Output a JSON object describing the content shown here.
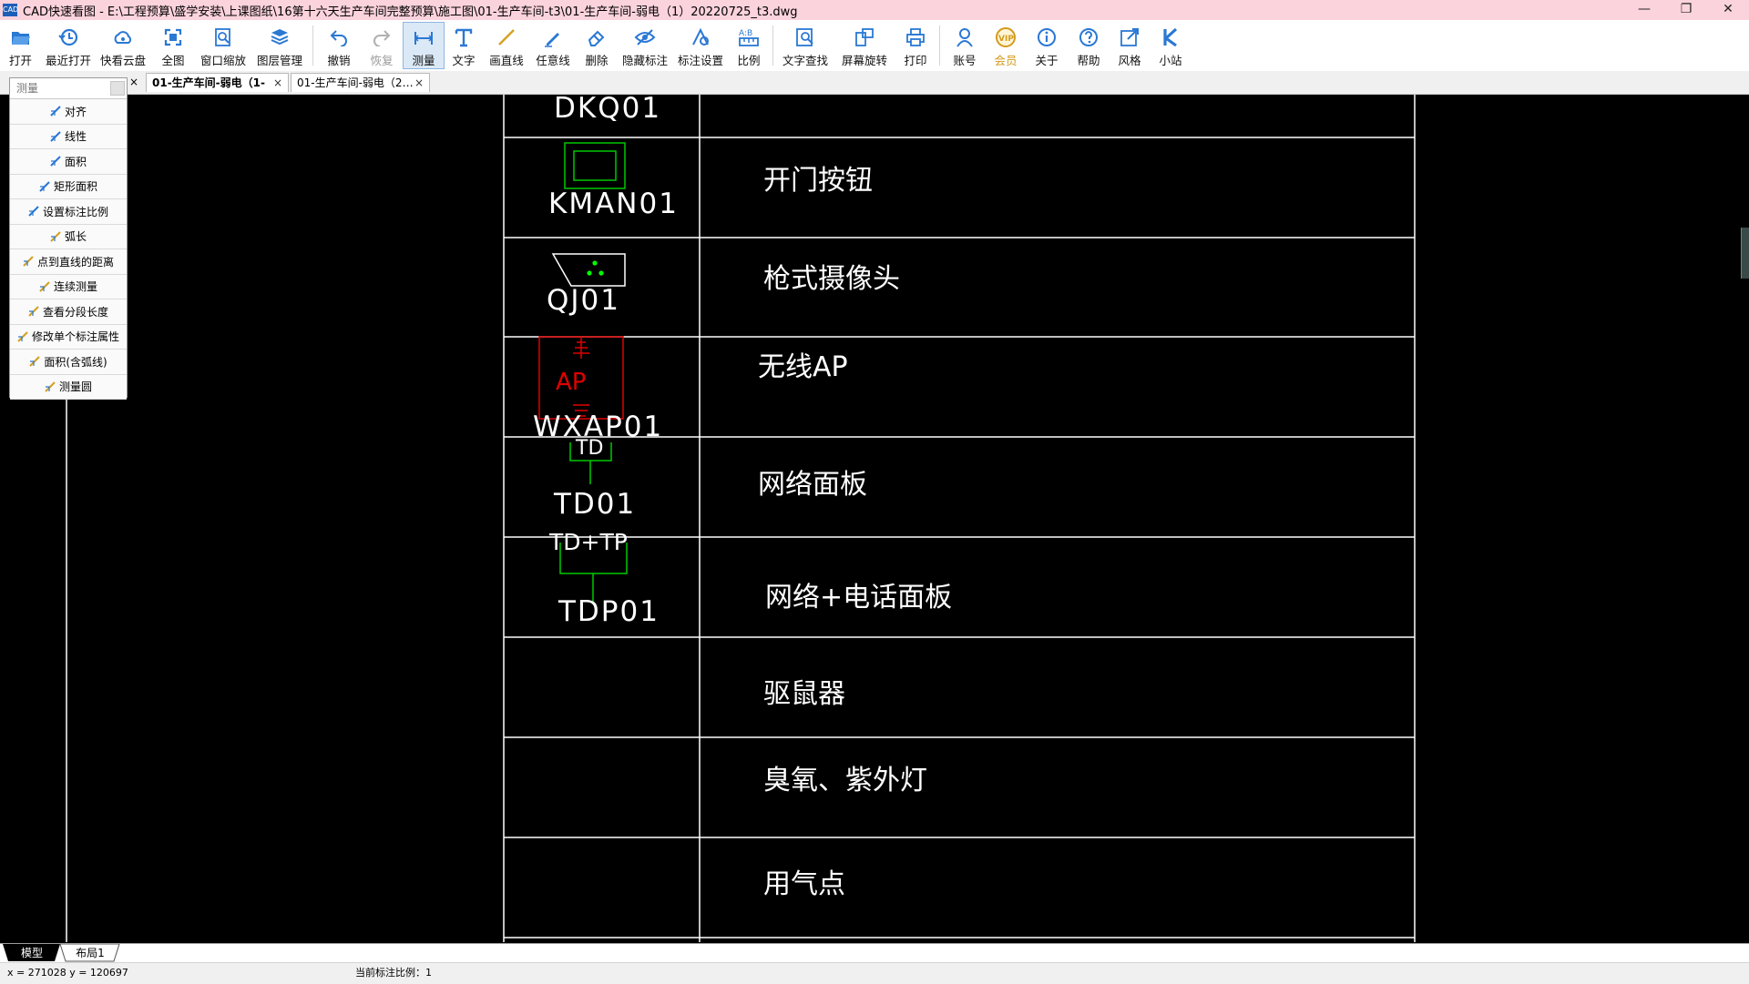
{
  "window": {
    "title": "CAD快速看图 - E:\\工程预算\\盛学安装\\上课图纸\\16第十六天生产车间完整预算\\施工图\\01-生产车间-t3\\01-生产车间-弱电（1）20220725_t3.dwg",
    "app_icon": "CAD"
  },
  "window_controls": {
    "minimize": "—",
    "maximize": "❐",
    "close": "✕"
  },
  "toolbar": {
    "items": [
      {
        "label": "打开",
        "icon": "folder-open-icon"
      },
      {
        "label": "最近打开",
        "icon": "history-icon"
      },
      {
        "label": "快看云盘",
        "icon": "cloud-icon"
      },
      {
        "label": "全图",
        "icon": "fit-all-icon"
      },
      {
        "label": "窗口缩放",
        "icon": "window-zoom-icon"
      },
      {
        "label": "图层管理",
        "icon": "layers-icon"
      },
      {
        "label": "撤销",
        "icon": "undo-icon"
      },
      {
        "label": "恢复",
        "icon": "redo-icon"
      },
      {
        "label": "测量",
        "icon": "measure-icon"
      },
      {
        "label": "文字",
        "icon": "text-icon"
      },
      {
        "label": "画直线",
        "icon": "line-icon"
      },
      {
        "label": "任意线",
        "icon": "pen-icon"
      },
      {
        "label": "删除",
        "icon": "eraser-icon"
      },
      {
        "label": "隐藏标注",
        "icon": "eye-hide-icon"
      },
      {
        "label": "标注设置",
        "icon": "annotation-settings-icon"
      },
      {
        "label": "比例",
        "icon": "scale-icon"
      },
      {
        "label": "文字查找",
        "icon": "text-search-icon"
      },
      {
        "label": "屏幕旋转",
        "icon": "rotate-screen-icon"
      },
      {
        "label": "打印",
        "icon": "print-icon"
      },
      {
        "label": "账号",
        "icon": "account-icon"
      },
      {
        "label": "会员",
        "icon": "vip-icon"
      },
      {
        "label": "关于",
        "icon": "info-icon"
      },
      {
        "label": "帮助",
        "icon": "help-icon"
      },
      {
        "label": "风格",
        "icon": "style-icon"
      },
      {
        "label": "小站",
        "icon": "k-station-icon"
      }
    ],
    "active": "测量",
    "accent": "#2a78d4",
    "vip_color": "#d49a1a"
  },
  "tabs": [
    {
      "label": "01-生产车间-弱电（1-",
      "active": true
    },
    {
      "label": "01-生产车间-弱电（2…",
      "active": false
    }
  ],
  "tab_close_glyph": "×",
  "measure_panel": {
    "placeholder": "测量",
    "items": [
      "对齐",
      "线性",
      "面积",
      "矩形面积",
      "设置标注比例",
      "弧长",
      "点到直线的距离",
      "连续测量",
      "查看分段长度",
      "修改单个标注属性",
      "面积(含弧线)",
      "测量圆"
    ]
  },
  "drawing": {
    "rows": [
      {
        "code": "DKQ01",
        "desc": ""
      },
      {
        "code": "KMAN01",
        "desc": "开门按钮"
      },
      {
        "code": "QJ01",
        "desc": "枪式摄像头"
      },
      {
        "code": "WXAP01",
        "desc": "无线AP",
        "symbol_text": "AP"
      },
      {
        "code": "TD01",
        "desc": "网络面板",
        "symbol_text": "TD"
      },
      {
        "code": "TDP01",
        "desc": "网络+电话面板",
        "symbol_text": "TD+TP"
      },
      {
        "code": "",
        "desc": "驱鼠器"
      },
      {
        "code": "",
        "desc": "臭氧、紫外灯"
      },
      {
        "code": "",
        "desc": "用气点"
      }
    ],
    "colors": {
      "line": "#ffffff",
      "green": "#00c800",
      "red": "#e00000",
      "dot": "#00ff00"
    }
  },
  "layout_tabs": [
    {
      "label": "模型",
      "active": true
    },
    {
      "label": "布局1",
      "active": false
    }
  ],
  "status": {
    "coords": "x = 271028  y = 120697",
    "scale": "当前标注比例：1"
  }
}
